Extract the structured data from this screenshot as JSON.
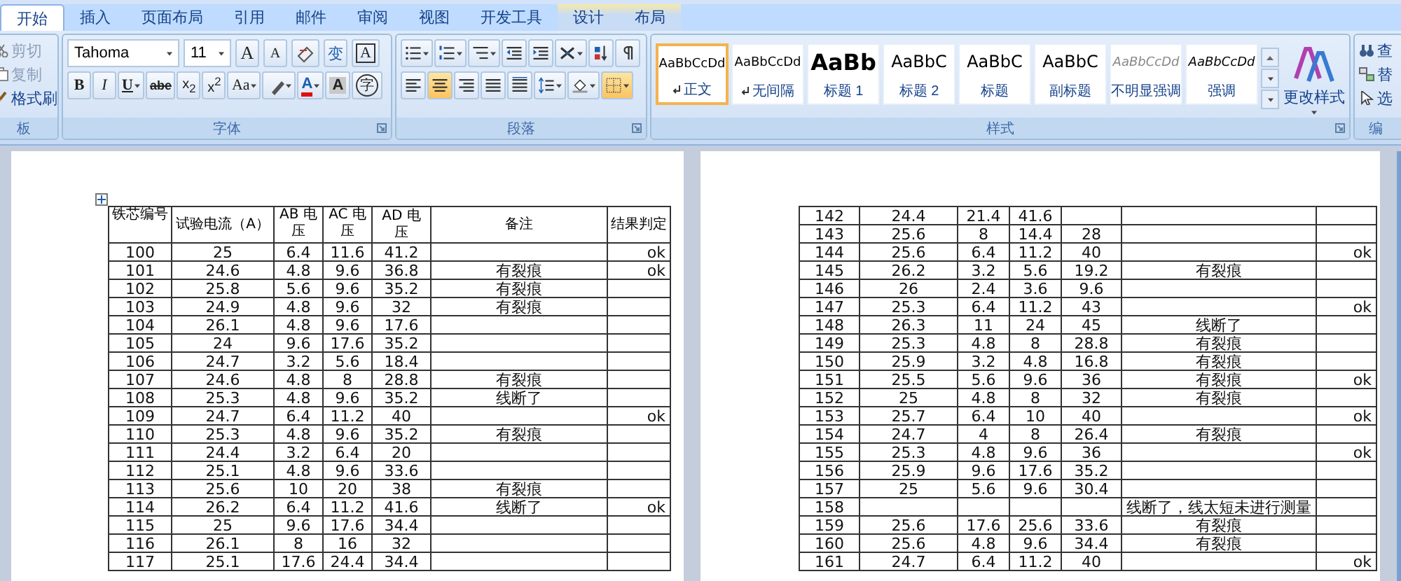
{
  "tabs": [
    {
      "label": "开始",
      "selected": true,
      "contextual": false
    },
    {
      "label": "插入",
      "selected": false,
      "contextual": false
    },
    {
      "label": "页面布局",
      "selected": false,
      "contextual": false
    },
    {
      "label": "引用",
      "selected": false,
      "contextual": false
    },
    {
      "label": "邮件",
      "selected": false,
      "contextual": false
    },
    {
      "label": "审阅",
      "selected": false,
      "contextual": false
    },
    {
      "label": "视图",
      "selected": false,
      "contextual": false
    },
    {
      "label": "开发工具",
      "selected": false,
      "contextual": false
    },
    {
      "label": "设计",
      "selected": false,
      "contextual": true
    },
    {
      "label": "布局",
      "selected": false,
      "contextual": true
    }
  ],
  "clipboard": {
    "label": "板",
    "items": [
      {
        "kind": "cut",
        "label": "剪切",
        "disabled": true
      },
      {
        "kind": "copy",
        "label": "复制",
        "disabled": true
      },
      {
        "kind": "brush",
        "label": "格式刷",
        "disabled": false
      }
    ]
  },
  "font": {
    "label": "字体",
    "font_name": "Tahoma",
    "font_size": "11",
    "row1": [
      {
        "kind": "grow",
        "text": "A"
      },
      {
        "kind": "shrink",
        "text": "A"
      },
      {
        "kind": "clear"
      },
      {
        "kind": "phonetic",
        "text": "变"
      },
      {
        "kind": "border",
        "text": "A"
      }
    ],
    "row2": [
      {
        "kind": "bold",
        "text": "B"
      },
      {
        "kind": "italic",
        "text": "I"
      },
      {
        "kind": "underline",
        "text": "U"
      },
      {
        "kind": "strike",
        "text": "abe"
      },
      {
        "kind": "sub",
        "text": "x$_{2}$"
      },
      {
        "kind": "sup",
        "text": "x$^{2}$"
      },
      {
        "kind": "case",
        "text": "Aa"
      },
      {
        "kind": "highlight"
      },
      {
        "kind": "color",
        "text": "A"
      },
      {
        "kind": "shade",
        "text": "A"
      },
      {
        "kind": "enclose",
        "text": "字"
      }
    ]
  },
  "paragraph": {
    "label": "段落",
    "row1": [
      {
        "kind": "bullets",
        "selected": false
      },
      {
        "kind": "numbering",
        "selected": false
      },
      {
        "kind": "multilevel",
        "selected": false
      },
      {
        "kind": "outdent",
        "selected": false
      },
      {
        "kind": "indent",
        "selected": false
      },
      {
        "kind": "asian",
        "selected": false
      },
      {
        "kind": "sort",
        "selected": false
      },
      {
        "kind": "marks",
        "selected": false
      }
    ],
    "row2": [
      {
        "kind": "left",
        "selected": false
      },
      {
        "kind": "center",
        "selected": true
      },
      {
        "kind": "right",
        "selected": false
      },
      {
        "kind": "justify",
        "selected": false
      },
      {
        "kind": "distribute",
        "selected": false
      },
      {
        "kind": "spacing",
        "selected": false
      },
      {
        "kind": "shading",
        "selected": false
      },
      {
        "kind": "borders",
        "selected": true
      }
    ]
  },
  "styles": {
    "label": "样式",
    "change_label": "更改样式",
    "items": [
      {
        "kind": "normal",
        "sample": "AaBbCcDd",
        "label": "正文",
        "selected": true,
        "paragraph_mark": true
      },
      {
        "kind": "normal",
        "sample": "AaBbCcDd",
        "label": "无间隔",
        "selected": false,
        "paragraph_mark": true
      },
      {
        "kind": "h1",
        "sample": "AaBb",
        "label": "标题 1",
        "selected": false,
        "paragraph_mark": false
      },
      {
        "kind": "h2",
        "sample": "AaBbC",
        "label": "标题 2",
        "selected": false,
        "paragraph_mark": false
      },
      {
        "kind": "h2",
        "sample": "AaBbC",
        "label": "标题",
        "selected": false,
        "paragraph_mark": false
      },
      {
        "kind": "h2",
        "sample": "AaBbC",
        "label": "副标题",
        "selected": false,
        "paragraph_mark": false
      },
      {
        "kind": "subtle",
        "sample": "AaBbCcDd",
        "label": "不明显强调",
        "selected": false,
        "paragraph_mark": false
      },
      {
        "kind": "emphasis",
        "sample": "AaBbCcDd",
        "label": "强调",
        "selected": false,
        "paragraph_mark": false
      }
    ]
  },
  "editing": {
    "label": "编",
    "items": [
      {
        "kind": "find",
        "label": "查"
      },
      {
        "kind": "replace",
        "label": "替"
      },
      {
        "kind": "select",
        "label": "选"
      }
    ]
  },
  "pages": [
    {
      "columns": [
        "铁芯编号",
        "试验电流（A）",
        "AB 电压",
        "AC 电压",
        "AD 电压",
        "备注",
        "结果判定"
      ],
      "rows": [
        [
          "100",
          "25",
          "6.4",
          "11.6",
          "41.2",
          null,
          "ok"
        ],
        [
          "101",
          "24.6",
          "4.8",
          "9.6",
          "36.8",
          "有裂痕",
          "ok"
        ],
        [
          "102",
          "25.8",
          "5.6",
          "9.6",
          "35.2",
          "有裂痕",
          null
        ],
        [
          "103",
          "24.9",
          "4.8",
          "9.6",
          "32",
          "有裂痕",
          null
        ],
        [
          "104",
          "26.1",
          "4.8",
          "9.6",
          "17.6",
          null,
          null
        ],
        [
          "105",
          "24",
          "9.6",
          "17.6",
          "35.2",
          null,
          null
        ],
        [
          "106",
          "24.7",
          "3.2",
          "5.6",
          "18.4",
          null,
          null
        ],
        [
          "107",
          "24.6",
          "4.8",
          "8",
          "28.8",
          "有裂痕",
          null
        ],
        [
          "108",
          "25.3",
          "4.8",
          "9.6",
          "35.2",
          "线断了",
          null
        ],
        [
          "109",
          "24.7",
          "6.4",
          "11.2",
          "40",
          null,
          "ok"
        ],
        [
          "110",
          "25.3",
          "4.8",
          "9.6",
          "35.2",
          "有裂痕",
          null
        ],
        [
          "111",
          "24.4",
          "3.2",
          "6.4",
          "20",
          null,
          null
        ],
        [
          "112",
          "25.1",
          "4.8",
          "9.6",
          "33.6",
          null,
          null
        ],
        [
          "113",
          "25.6",
          "10",
          "20",
          "38",
          "有裂痕",
          null
        ],
        [
          "114",
          "26.2",
          "6.4",
          "11.2",
          "41.6",
          "线断了",
          "ok"
        ],
        [
          "115",
          "25",
          "9.6",
          "17.6",
          "34.4",
          null,
          null
        ],
        [
          "116",
          "26.1",
          "8",
          "16",
          "32",
          null,
          null
        ],
        [
          "117",
          "25.1",
          "17.6",
          "24.4",
          "34.4",
          null,
          null
        ]
      ]
    },
    {
      "rows": [
        [
          "142",
          "24.4",
          "21.4",
          "41.6",
          null,
          null,
          null
        ],
        [
          "143",
          "25.6",
          "8",
          "14.4",
          "28",
          null,
          null
        ],
        [
          "144",
          "25.6",
          "6.4",
          "11.2",
          "40",
          null,
          "ok"
        ],
        [
          "145",
          "26.2",
          "3.2",
          "5.6",
          "19.2",
          "有裂痕",
          null
        ],
        [
          "146",
          "26",
          "2.4",
          "3.6",
          "9.6",
          null,
          null
        ],
        [
          "147",
          "25.3",
          "6.4",
          "11.2",
          "43",
          null,
          "ok"
        ],
        [
          "148",
          "26.3",
          "11",
          "24",
          "45",
          "线断了",
          null
        ],
        [
          "149",
          "25.3",
          "4.8",
          "8",
          "28.8",
          "有裂痕",
          null
        ],
        [
          "150",
          "25.9",
          "3.2",
          "4.8",
          "16.8",
          "有裂痕",
          null
        ],
        [
          "151",
          "25.5",
          "5.6",
          "9.6",
          "36",
          "有裂痕",
          "ok"
        ],
        [
          "152",
          "25",
          "4.8",
          "8",
          "32",
          "有裂痕",
          null
        ],
        [
          "153",
          "25.7",
          "6.4",
          "10",
          "40",
          null,
          "ok"
        ],
        [
          "154",
          "24.7",
          "4",
          "8",
          "26.4",
          "有裂痕",
          null
        ],
        [
          "155",
          "25.3",
          "4.8",
          "9.6",
          "36",
          null,
          "ok"
        ],
        [
          "156",
          "25.9",
          "9.6",
          "17.6",
          "35.2",
          null,
          null
        ],
        [
          "157",
          "25",
          "5.6",
          "9.6",
          "30.4",
          null,
          null
        ],
        [
          "158",
          null,
          null,
          null,
          null,
          "线断了，线太短未进行测量",
          null
        ],
        [
          "159",
          "25.6",
          "17.6",
          "25.6",
          "33.6",
          "有裂痕",
          null
        ],
        [
          "160",
          "25.6",
          "4.8",
          "9.6",
          "34.4",
          "有裂痕",
          null
        ],
        [
          "161",
          "24.7",
          "6.4",
          "11.2",
          "40",
          null,
          "ok"
        ]
      ]
    }
  ]
}
